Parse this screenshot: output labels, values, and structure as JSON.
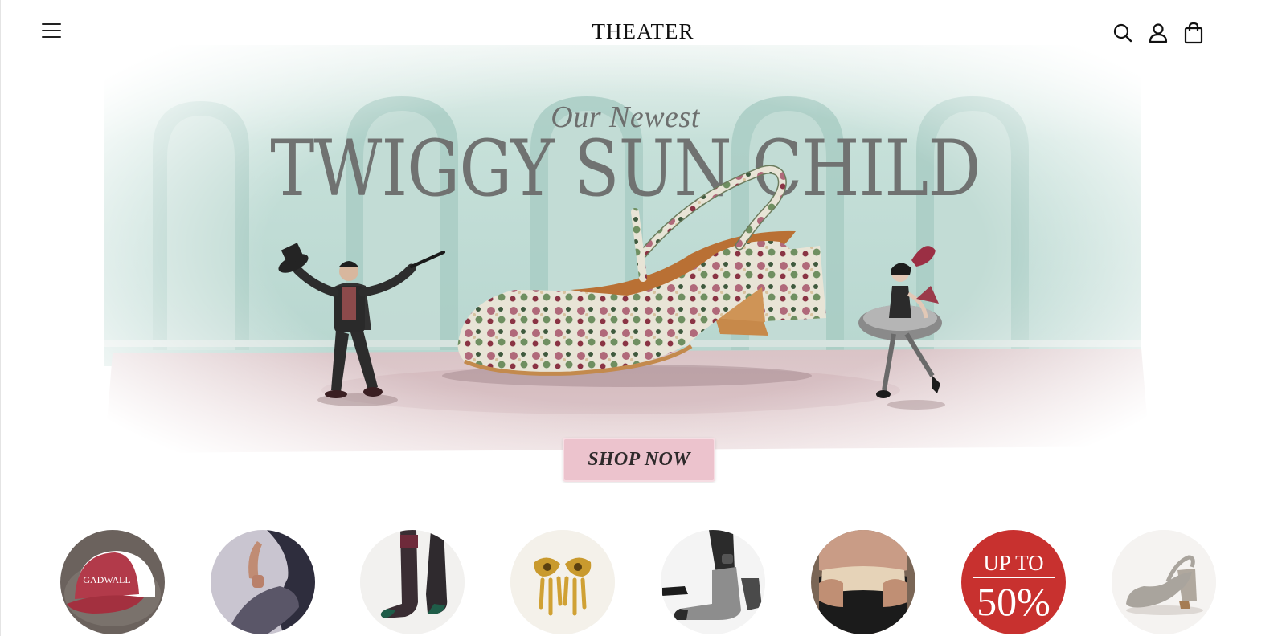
{
  "header": {
    "logo": "THEATER",
    "icons": [
      "menu-icon",
      "search-icon",
      "account-icon",
      "cart-icon"
    ]
  },
  "hero": {
    "eyebrow": "Our Newest",
    "title": "TWIGGY SUN CHILD",
    "cta_label": "SHOP NOW"
  },
  "categories": [
    {
      "name": "cap",
      "cap_text": "GADWALL"
    },
    {
      "name": "tights"
    },
    {
      "name": "sheer-socks"
    },
    {
      "name": "gold-earrings"
    },
    {
      "name": "mens-socks"
    },
    {
      "name": "thermal-leggings"
    },
    {
      "name": "sale",
      "promo_top": "UP TO",
      "promo_value": "50%"
    },
    {
      "name": "slingback-shoe"
    }
  ],
  "colors": {
    "accent_pink": "#ecc3cd",
    "sale_red": "#c8312f",
    "wall_teal": "#bcdcd4",
    "floor_rose": "#dcc2c6"
  }
}
